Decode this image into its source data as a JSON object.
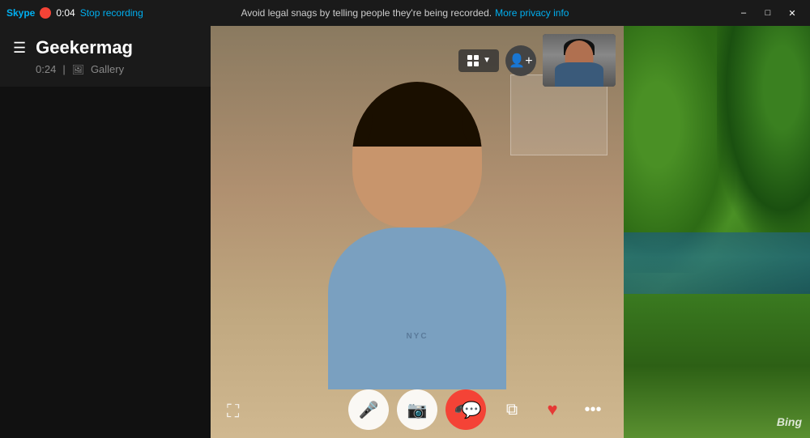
{
  "titleBar": {
    "appName": "Skype",
    "recordingTimer": "0:04",
    "stopRecordingLabel": "Stop recording",
    "recordingNotice": "Avoid legal snags by telling people they're being recorded.",
    "privacyLink": "More privacy info",
    "minimizeLabel": "–",
    "maximizeLabel": "□",
    "closeLabel": "✕"
  },
  "sidebar": {
    "contactName": "Geekermag",
    "callDuration": "0:24",
    "galleryLabel": "Gallery",
    "hamburgerIcon": "☰"
  },
  "videoArea": {
    "mainVideoLabel": "Main video feed",
    "miniVideoLabel": "Self-view mini video",
    "expandIconLabel": "⬜",
    "layoutIcon": "⊞",
    "addPersonIcon": "+"
  },
  "controls": {
    "micLabel": "🎤",
    "cameraLabel": "📷",
    "endCallLabel": "📞",
    "chatLabel": "💬",
    "copyLabel": "⧉",
    "heartLabel": "♥",
    "moreLabel": "•••"
  },
  "colors": {
    "accent": "#00aff0",
    "endCall": "#f44336",
    "heart": "#e53935",
    "titleBg": "#1a1a1a",
    "sidebarBg": "#1a1a1a",
    "videoBg": "#000000"
  }
}
